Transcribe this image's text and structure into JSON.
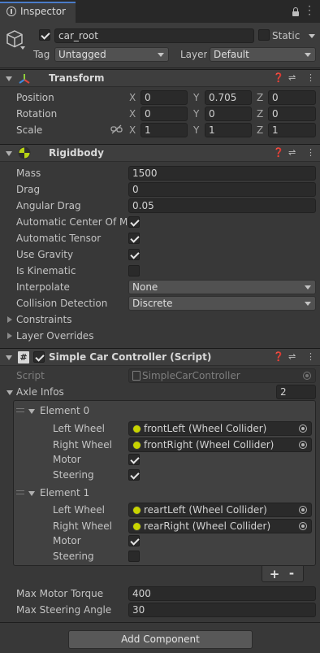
{
  "tab": {
    "title": "Inspector"
  },
  "header": {
    "object_active": true,
    "object_name": "car_root",
    "static_label": "Static",
    "static_checked": false,
    "tag_label": "Tag",
    "tag_value": "Untagged",
    "layer_label": "Layer",
    "layer_value": "Default"
  },
  "transform": {
    "title": "Transform",
    "position": {
      "label": "Position",
      "x": "0",
      "y": "0.705",
      "z": "0"
    },
    "rotation": {
      "label": "Rotation",
      "x": "0",
      "y": "0",
      "z": "0"
    },
    "scale": {
      "label": "Scale",
      "x": "1",
      "y": "1",
      "z": "1"
    },
    "axis": {
      "x": "X",
      "y": "Y",
      "z": "Z"
    }
  },
  "rigidbody": {
    "title": "Rigidbody",
    "mass_label": "Mass",
    "mass": "1500",
    "drag_label": "Drag",
    "drag": "0",
    "angular_drag_label": "Angular Drag",
    "angular_drag": "0.05",
    "auto_center_label": "Automatic Center Of Ma",
    "auto_center": true,
    "auto_tensor_label": "Automatic Tensor",
    "auto_tensor": true,
    "use_gravity_label": "Use Gravity",
    "use_gravity": true,
    "is_kinematic_label": "Is Kinematic",
    "is_kinematic": false,
    "interpolate_label": "Interpolate",
    "interpolate": "None",
    "collision_label": "Collision Detection",
    "collision": "Discrete",
    "constraints_label": "Constraints",
    "layer_overrides_label": "Layer Overrides"
  },
  "script_component": {
    "title": "Simple Car Controller (Script)",
    "enabled": true,
    "script_label": "Script",
    "script_value": "SimpleCarController",
    "axle_infos_label": "Axle Infos",
    "axle_infos_count": "2",
    "elements": [
      {
        "title": "Element 0",
        "left_wheel_label": "Left Wheel",
        "left_wheel": "frontLeft (Wheel Collider)",
        "right_wheel_label": "Right Wheel",
        "right_wheel": "frontRight (Wheel Collider)",
        "motor_label": "Motor",
        "motor": true,
        "steering_label": "Steering",
        "steering": true
      },
      {
        "title": "Element 1",
        "left_wheel_label": "Left Wheel",
        "left_wheel": "reartLeft (Wheel Collider)",
        "right_wheel_label": "Right Wheel",
        "right_wheel": "rearRight (Wheel Collider)",
        "motor_label": "Motor",
        "motor": true,
        "steering_label": "Steering",
        "steering": false
      }
    ],
    "add_label": "+",
    "remove_label": "-",
    "max_motor_torque_label": "Max Motor Torque",
    "max_motor_torque": "400",
    "max_steering_angle_label": "Max Steering Angle",
    "max_steering_angle": "30"
  },
  "add_component": {
    "label": "Add Component"
  }
}
